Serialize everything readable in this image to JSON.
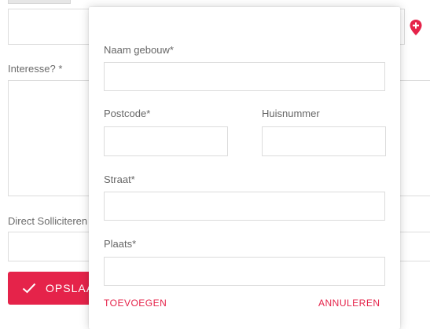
{
  "background": {
    "interest_label": "Interesse? *",
    "direct_label": "Direct Solliciteren",
    "save_button_label": "OPSLAAN"
  },
  "modal": {
    "name_label": "Naam gebouw*",
    "postcode_label": "Postcode*",
    "housenumber_label": "Huisnummer",
    "street_label": "Straat*",
    "place_label": "Plaats*",
    "add_label": "TOEVOEGEN",
    "cancel_label": "ANNULEREN"
  },
  "colors": {
    "accent": "#e5234a",
    "marker": "#e5234a"
  },
  "icons": {
    "save": "checkmark-icon",
    "location": "map-marker-plus-icon"
  }
}
